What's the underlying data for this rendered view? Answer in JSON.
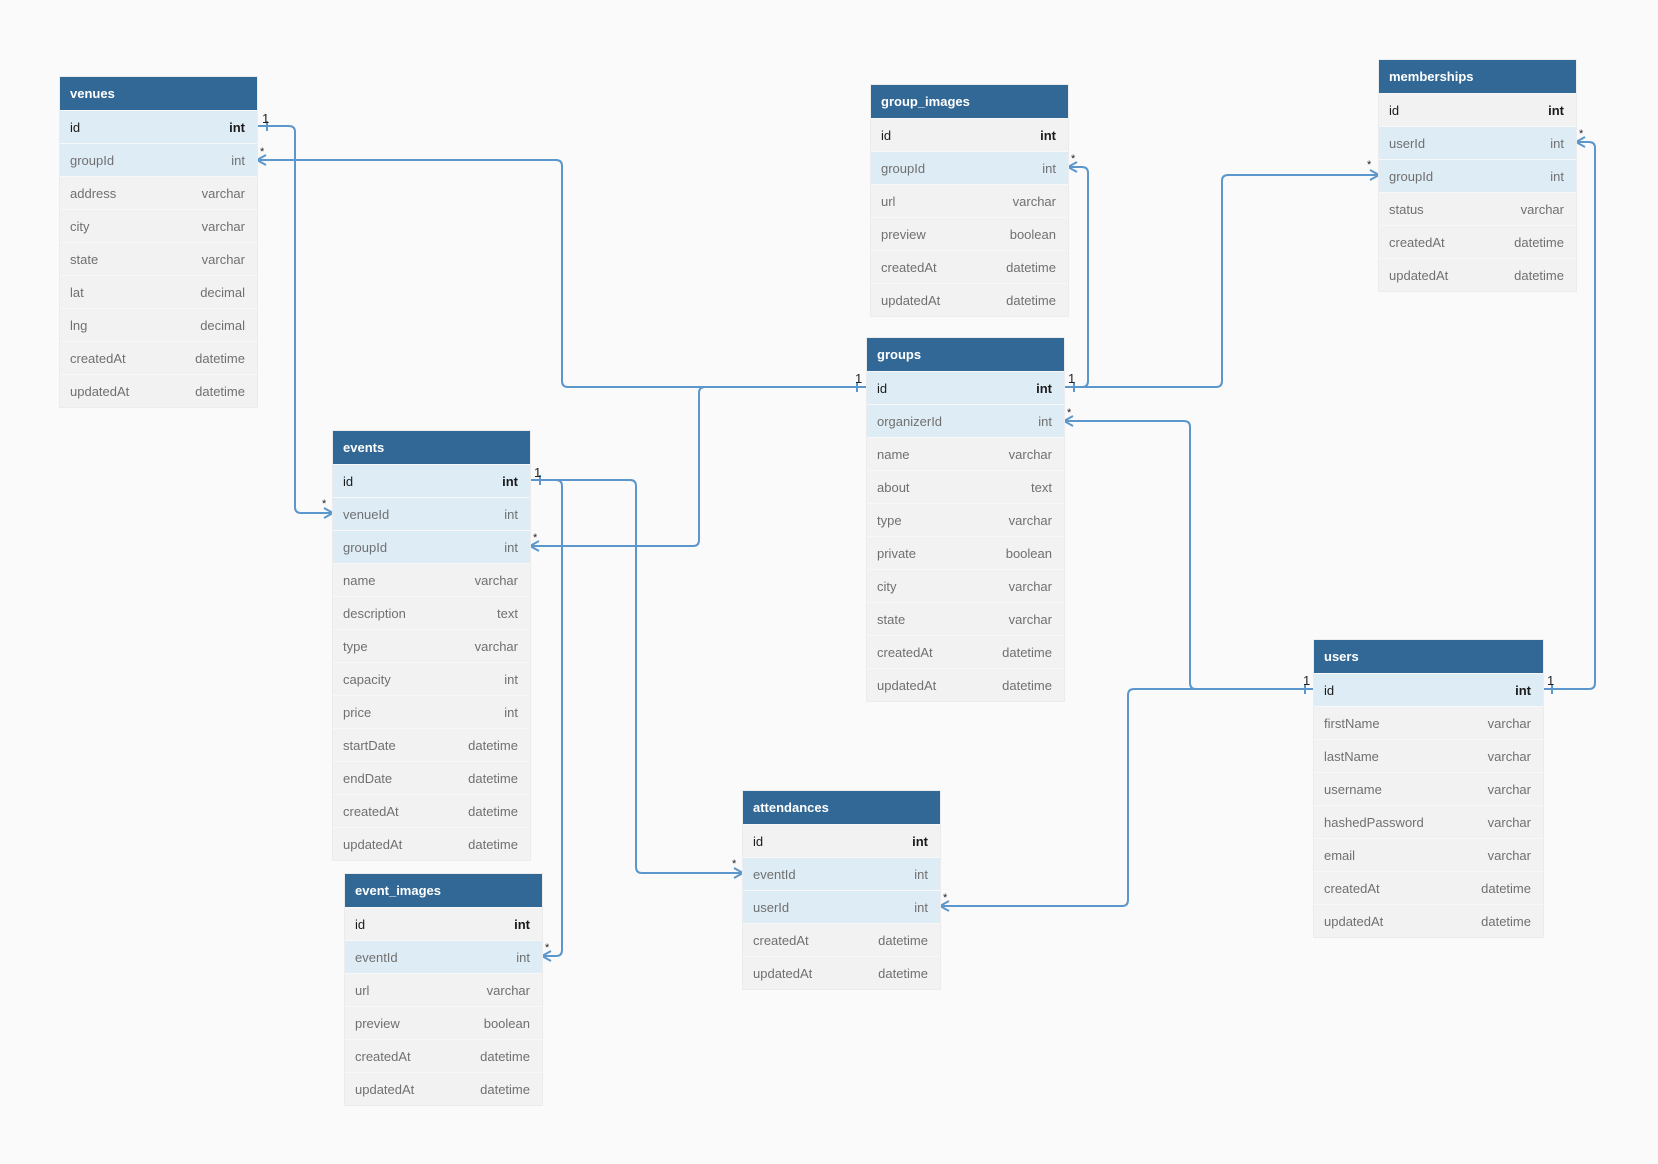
{
  "colors": {
    "header": "#316896",
    "link": "#5b97cc",
    "key_row": "#deecf5",
    "row": "#f2f2f2",
    "background": "#fafafa"
  },
  "tables": {
    "venues": {
      "name": "venues",
      "fields": [
        {
          "name": "id",
          "type": "int",
          "pk": true,
          "key": true
        },
        {
          "name": "groupId",
          "type": "int",
          "key": true
        },
        {
          "name": "address",
          "type": "varchar"
        },
        {
          "name": "city",
          "type": "varchar"
        },
        {
          "name": "state",
          "type": "varchar"
        },
        {
          "name": "lat",
          "type": "decimal"
        },
        {
          "name": "lng",
          "type": "decimal"
        },
        {
          "name": "createdAt",
          "type": "datetime"
        },
        {
          "name": "updatedAt",
          "type": "datetime"
        }
      ]
    },
    "events": {
      "name": "events",
      "fields": [
        {
          "name": "id",
          "type": "int",
          "pk": true,
          "key": true
        },
        {
          "name": "venueId",
          "type": "int",
          "key": true
        },
        {
          "name": "groupId",
          "type": "int",
          "key": true
        },
        {
          "name": "name",
          "type": "varchar"
        },
        {
          "name": "description",
          "type": "text"
        },
        {
          "name": "type",
          "type": "varchar"
        },
        {
          "name": "capacity",
          "type": "int"
        },
        {
          "name": "price",
          "type": "int"
        },
        {
          "name": "startDate",
          "type": "datetime"
        },
        {
          "name": "endDate",
          "type": "datetime"
        },
        {
          "name": "createdAt",
          "type": "datetime"
        },
        {
          "name": "updatedAt",
          "type": "datetime"
        }
      ]
    },
    "event_images": {
      "name": "event_images",
      "fields": [
        {
          "name": "id",
          "type": "int",
          "pk": true
        },
        {
          "name": "eventId",
          "type": "int",
          "key": true
        },
        {
          "name": "url",
          "type": "varchar"
        },
        {
          "name": "preview",
          "type": "boolean"
        },
        {
          "name": "createdAt",
          "type": "datetime"
        },
        {
          "name": "updatedAt",
          "type": "datetime"
        }
      ]
    },
    "group_images": {
      "name": "group_images",
      "fields": [
        {
          "name": "id",
          "type": "int",
          "pk": true
        },
        {
          "name": "groupId",
          "type": "int",
          "key": true
        },
        {
          "name": "url",
          "type": "varchar"
        },
        {
          "name": "preview",
          "type": "boolean"
        },
        {
          "name": "createdAt",
          "type": "datetime"
        },
        {
          "name": "updatedAt",
          "type": "datetime"
        }
      ]
    },
    "groups": {
      "name": "groups",
      "fields": [
        {
          "name": "id",
          "type": "int",
          "pk": true,
          "key": true
        },
        {
          "name": "organizerId",
          "type": "int",
          "key": true
        },
        {
          "name": "name",
          "type": "varchar"
        },
        {
          "name": "about",
          "type": "text"
        },
        {
          "name": "type",
          "type": "varchar"
        },
        {
          "name": "private",
          "type": "boolean"
        },
        {
          "name": "city",
          "type": "varchar"
        },
        {
          "name": "state",
          "type": "varchar"
        },
        {
          "name": "createdAt",
          "type": "datetime"
        },
        {
          "name": "updatedAt",
          "type": "datetime"
        }
      ]
    },
    "memberships": {
      "name": "memberships",
      "fields": [
        {
          "name": "id",
          "type": "int",
          "pk": true
        },
        {
          "name": "userId",
          "type": "int",
          "key": true
        },
        {
          "name": "groupId",
          "type": "int",
          "key": true
        },
        {
          "name": "status",
          "type": "varchar"
        },
        {
          "name": "createdAt",
          "type": "datetime"
        },
        {
          "name": "updatedAt",
          "type": "datetime"
        }
      ]
    },
    "attendances": {
      "name": "attendances",
      "fields": [
        {
          "name": "id",
          "type": "int",
          "pk": true
        },
        {
          "name": "eventId",
          "type": "int",
          "key": true
        },
        {
          "name": "userId",
          "type": "int",
          "key": true
        },
        {
          "name": "createdAt",
          "type": "datetime"
        },
        {
          "name": "updatedAt",
          "type": "datetime"
        }
      ]
    },
    "users": {
      "name": "users",
      "fields": [
        {
          "name": "id",
          "type": "int",
          "pk": true,
          "key": true
        },
        {
          "name": "firstName",
          "type": "varchar"
        },
        {
          "name": "lastName",
          "type": "varchar"
        },
        {
          "name": "username",
          "type": "varchar"
        },
        {
          "name": "hashedPassword",
          "type": "varchar"
        },
        {
          "name": "email",
          "type": "varchar"
        },
        {
          "name": "createdAt",
          "type": "datetime"
        },
        {
          "name": "updatedAt",
          "type": "datetime"
        }
      ]
    }
  },
  "relationships": [
    {
      "from": "venues.id",
      "to": "events.venueId",
      "from_card": "1",
      "to_card": "*"
    },
    {
      "from": "groups.id",
      "to": "venues.groupId",
      "from_card": "1",
      "to_card": "*"
    },
    {
      "from": "groups.id",
      "to": "events.groupId",
      "from_card": "1",
      "to_card": "*"
    },
    {
      "from": "groups.id",
      "to": "group_images.groupId",
      "from_card": "1",
      "to_card": "*"
    },
    {
      "from": "groups.id",
      "to": "memberships.groupId",
      "from_card": "1",
      "to_card": "*"
    },
    {
      "from": "events.id",
      "to": "event_images.eventId",
      "from_card": "1",
      "to_card": "*"
    },
    {
      "from": "events.id",
      "to": "attendances.eventId",
      "from_card": "1",
      "to_card": "*"
    },
    {
      "from": "users.id",
      "to": "groups.organizerId",
      "from_card": "1",
      "to_card": "*"
    },
    {
      "from": "users.id",
      "to": "attendances.userId",
      "from_card": "1",
      "to_card": "*"
    },
    {
      "from": "users.id",
      "to": "memberships.userId",
      "from_card": "1",
      "to_card": "*"
    }
  ]
}
